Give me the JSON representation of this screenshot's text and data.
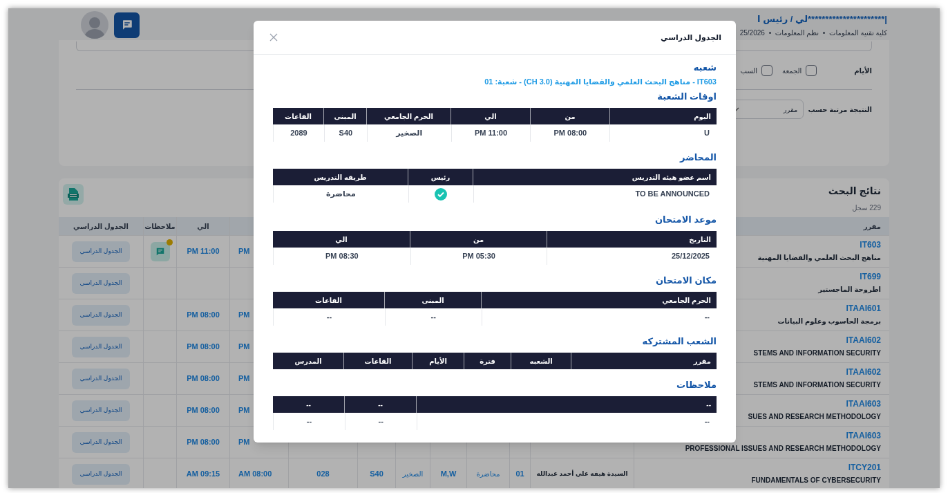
{
  "header": {
    "user_name": "|**********************لي / رئيس ا",
    "breadcrumb": [
      "كلية تقنية المعلومات",
      "نظم المعلومات",
      "25/2026"
    ]
  },
  "filters": {
    "days_label": "الأيام",
    "days": [
      {
        "label": "الجمعة",
        "checked": false
      },
      {
        "label": "السب",
        "checked": false
      }
    ],
    "sort_label": "النتيجة مرتبة حسب",
    "sort_value": "مقرر"
  },
  "results": {
    "title": "نتائج البحث",
    "count": "229 سجل",
    "columns": {
      "course": "مقرر",
      "to": "الي",
      "notes": "ملاحظات",
      "schedule": "الجدول الدراسي"
    },
    "rows": [
      {
        "course_code": "IT603",
        "course_name": "مناهج البحث العلمي والقضايا المهنية",
        "from": "PM",
        "to": "PM 11:00",
        "has_note": true,
        "schedule_button": "الجدول الدراسي"
      },
      {
        "course_code": "IT699",
        "course_name": "اطروحة الماجستير",
        "has_note": false,
        "schedule_button": "الجدول الدراسي"
      },
      {
        "course_code": "ITAAI601",
        "course_name": "برمجة الحاسوب وعلوم البيانات",
        "from": "PM",
        "to": "PM 08:00",
        "has_note": false,
        "schedule_button": "الجدول الدراسي"
      },
      {
        "course_code": "ITAAI602",
        "course_name": "STEMS AND INFORMATION SECURITY",
        "from": "PM",
        "to": "PM 08:00",
        "has_note": false,
        "schedule_button": "الجدول الدراسي"
      },
      {
        "course_code": "ITAAI602",
        "course_name": "STEMS AND INFORMATION SECURITY",
        "from": "PM",
        "to": "PM 08:00",
        "has_note": false,
        "schedule_button": "الجدول الدراسي"
      },
      {
        "course_code": "ITAAI603",
        "course_name": "SUES AND RESEARCH METHODOLOGY",
        "from": "PM",
        "to": "PM 08:00",
        "has_note": false,
        "schedule_button": "الجدول الدراسي"
      },
      {
        "course_code": "ITAAI603",
        "course_name": "PROFESSIONAL ISSUES AND RESEARCH METHODOLOGY",
        "from": "PM",
        "to": "PM 08:00",
        "has_note": false,
        "schedule_button": "الجدول الدراسي"
      },
      {
        "course_code": "ITCY201",
        "course_name": "FUNDAMENTALS OF CYBERSECURITY",
        "instructor": "السيدة هيفه علي أحمد عبدالله",
        "section": "01",
        "type": "محاضرة",
        "days": "M,W",
        "campus": "الصخير",
        "building": "S40",
        "rooms": "028",
        "from": "AM 08:00",
        "to": "AM 09:15",
        "has_note": false,
        "schedule_button": "الجدول الدراسي"
      }
    ]
  },
  "modal": {
    "title": "الجدول الدراسي",
    "sections": [
      {
        "kind": "text",
        "heading": "شعبه",
        "text": "IT603 - مناهج البحث العلمي والقضايا المهنية (CH 3.0) - شعبة: 01"
      },
      {
        "kind": "table",
        "heading": "اوقات الشعبة",
        "columns": [
          "اليوم",
          "من",
          "الي",
          "الحرم الجامعي",
          "المبنى",
          "القاعات"
        ],
        "rows": [
          [
            "U",
            "PM 08:00",
            "PM 11:00",
            "الصخير",
            "S40",
            "2089"
          ]
        ]
      },
      {
        "kind": "table",
        "heading": "المحاضر",
        "columns": [
          "اسم عضو هيئه التدريس",
          "رئيس",
          "طريقه التدريس"
        ],
        "rows": [
          [
            "TO BE ANNOUNCED",
            {
              "checked": true
            },
            "محاضرة"
          ]
        ]
      },
      {
        "kind": "table",
        "heading": "موعد الامتحان",
        "columns": [
          "التاريخ",
          "من",
          "الي"
        ],
        "rows": [
          [
            "25/12/2025",
            "PM 05:30",
            "PM 08:30"
          ]
        ]
      },
      {
        "kind": "table",
        "heading": "مكان الامتحان",
        "columns": [
          "الحرم الجامعي",
          "المبنى",
          "القاعات"
        ],
        "rows": [
          [
            "--",
            "--",
            "--"
          ]
        ]
      },
      {
        "kind": "table",
        "heading": "الشعب المشتركه",
        "columns": [
          "مقرر",
          "الشعبه",
          "فترة",
          "الأيام",
          "القاعات",
          "المدرس"
        ]
      },
      {
        "kind": "table",
        "heading": "ملاحظات",
        "columns": [
          "--",
          "--",
          "--"
        ],
        "rows": [
          [
            "--",
            "--",
            "--"
          ]
        ]
      }
    ]
  }
}
